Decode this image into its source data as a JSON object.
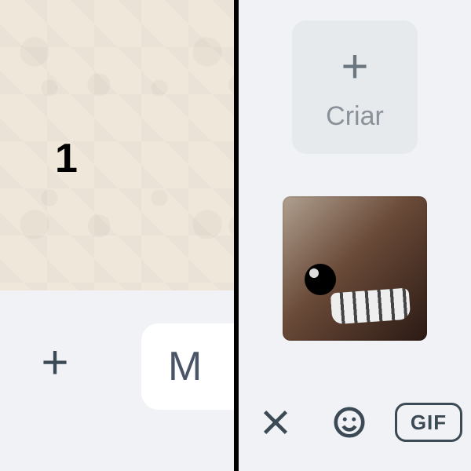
{
  "panel_number": "1",
  "left_bar": {
    "message_placeholder_fragment": "M"
  },
  "right_panel": {
    "create_label": "Criar",
    "gif_label": "GIF"
  }
}
